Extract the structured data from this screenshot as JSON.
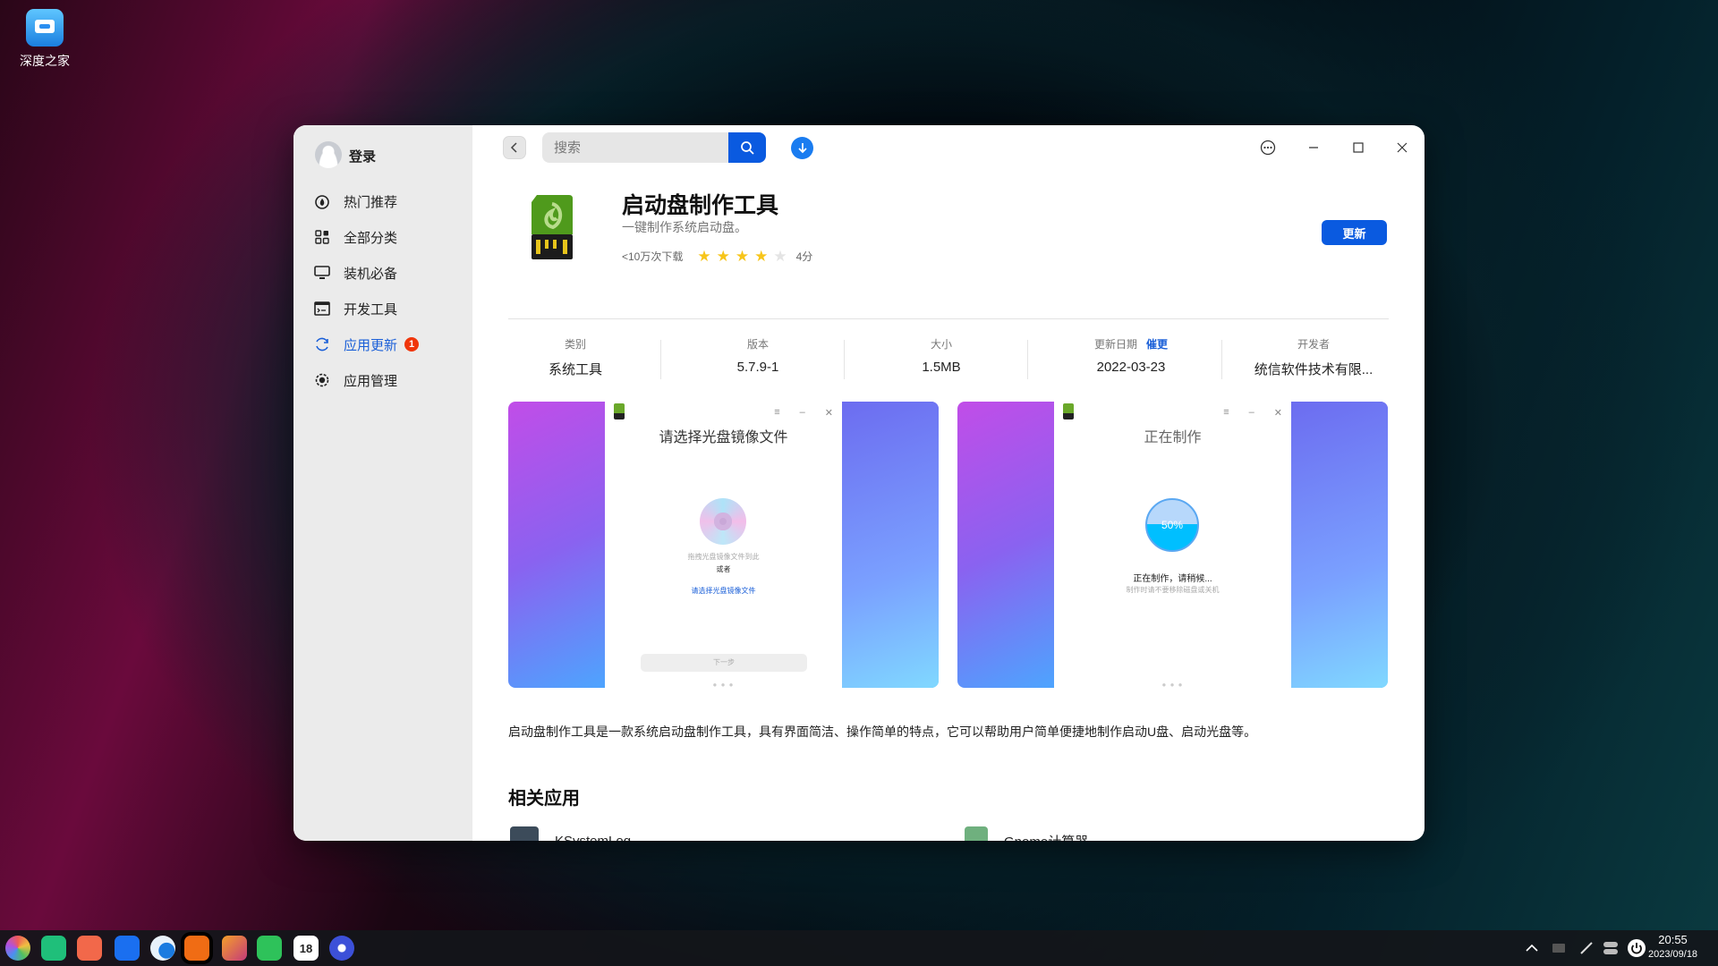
{
  "desktop": {
    "icon_label": "深度之家"
  },
  "sidebar": {
    "login": "登录",
    "items": [
      {
        "label": "热门推荐",
        "icon": "fire-icon"
      },
      {
        "label": "全部分类",
        "icon": "grid-icon"
      },
      {
        "label": "装机必备",
        "icon": "monitor-icon"
      },
      {
        "label": "开发工具",
        "icon": "terminal-icon"
      },
      {
        "label": "应用更新",
        "icon": "refresh-icon",
        "active": true,
        "badge": "1"
      },
      {
        "label": "应用管理",
        "icon": "gear-icon"
      }
    ]
  },
  "toolbar": {
    "search_placeholder": "搜索"
  },
  "app": {
    "name": "启动盘制作工具",
    "tagline": "一键制作系统启动盘。",
    "downloads": "<10万次下载",
    "rating": 4,
    "rating_max": 5,
    "rating_label": "4分",
    "update_label": "更新"
  },
  "info": [
    {
      "label": "类别",
      "value": "系统工具"
    },
    {
      "label": "版本",
      "value": "5.7.9-1"
    },
    {
      "label": "大小",
      "value": "1.5MB"
    },
    {
      "label": "更新日期",
      "link": "催更",
      "value": "2022-03-23"
    },
    {
      "label": "开发者",
      "value": "统信软件技术有限..."
    }
  ],
  "screenshots": [
    {
      "heading": "请选择光盘镜像文件",
      "drag": "拖拽光盘镜像文件到此",
      "or": "或者",
      "link": "请选择光盘镜像文件",
      "next": "下一步"
    },
    {
      "heading": "正在制作",
      "progress": "50%",
      "status": "正在制作，请稍候...",
      "hint": "制作时请不要移除磁盘或关机"
    }
  ],
  "description": "启动盘制作工具是一款系统启动盘制作工具，具有界面简洁、操作简单的特点，它可以帮助用户简单便捷地制作启动U盘、启动光盘等。",
  "related": {
    "title": "相关应用",
    "items": [
      "KSystemLog",
      "Gnome计算器"
    ]
  },
  "taskbar": {
    "time": "20:55",
    "date": "2023/09/18",
    "calendar_day": "18"
  },
  "colors": {
    "accent": "#0a5ae0",
    "badge": "#f0360b",
    "star": "#f7c51a"
  }
}
